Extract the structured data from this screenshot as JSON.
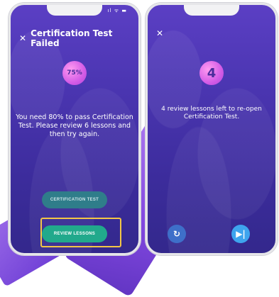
{
  "left_screen": {
    "status_icons": "ıl ᯤ ▬",
    "title": "Certification Test Failed",
    "score_badge": "75%",
    "message": "You need 80% to pass Certification Test. Please review  6  lessons and then try again.",
    "cert_button": "CERTIFICATION TEST",
    "review_button": "REVIEW LESSONS"
  },
  "right_screen": {
    "count_badge": "4",
    "message": "4 review lessons left to re-open Certification Test.",
    "replay_icon": "↻",
    "next_icon": "▶|"
  },
  "colors": {
    "bg_top": "#5b3fc4",
    "bg_bottom": "#33288c",
    "badge": "#d45ce6",
    "review_button": "#21a98c",
    "cert_button": "#2f7d8a",
    "highlight": "#f3c646"
  },
  "icons": {
    "close": "close-icon",
    "replay": "replay-icon",
    "next": "skip-next-icon"
  }
}
